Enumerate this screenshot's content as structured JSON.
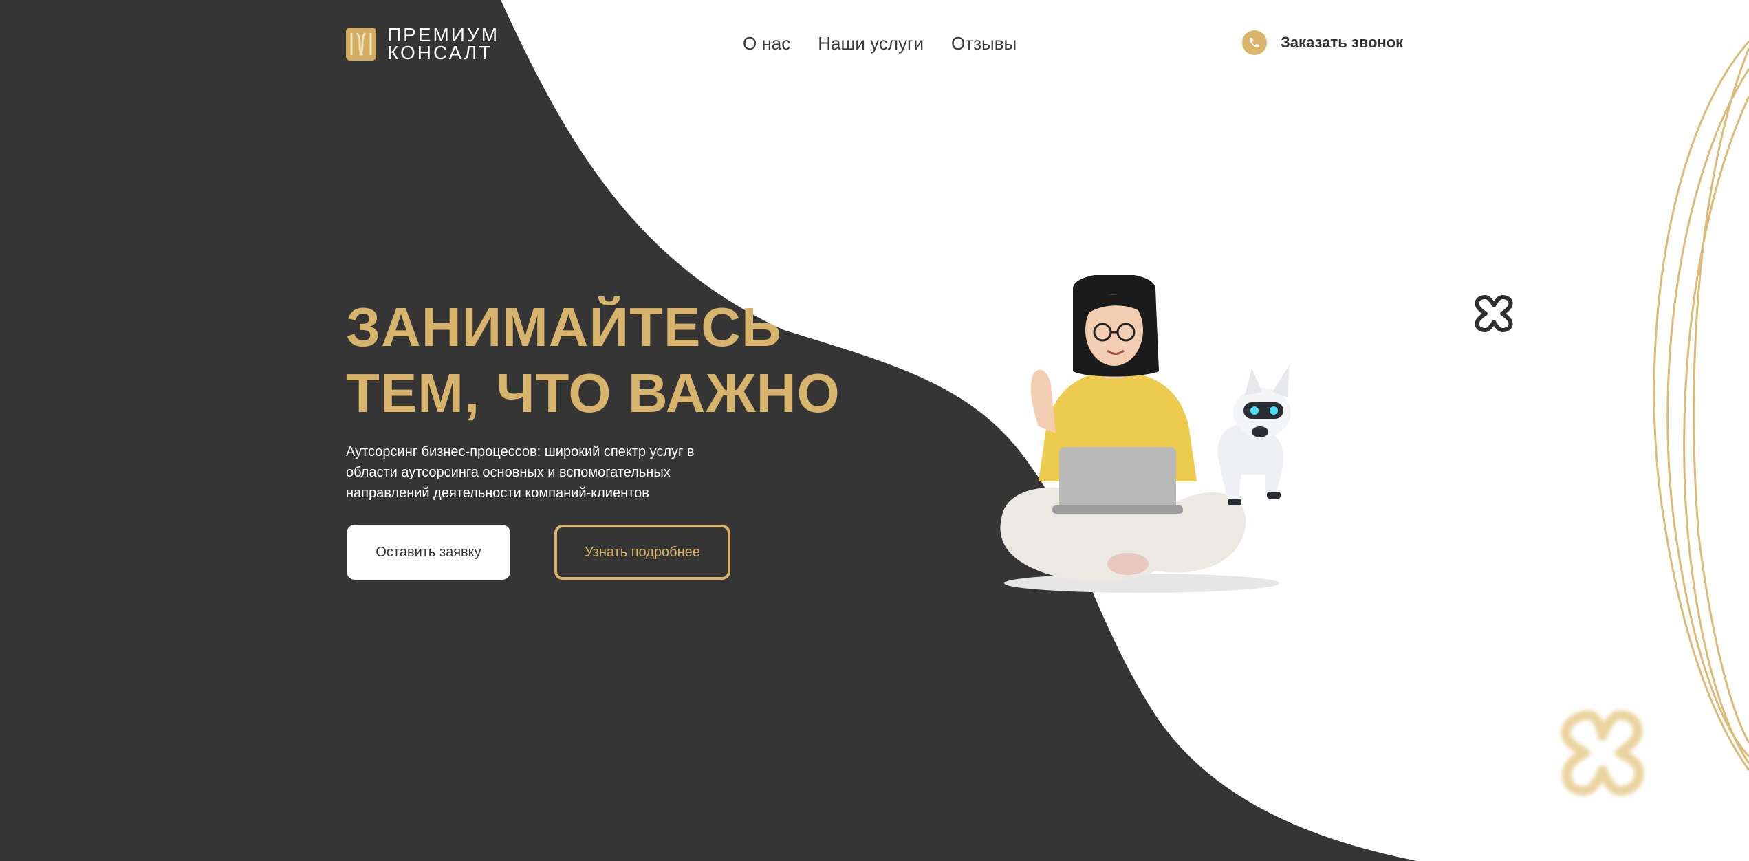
{
  "header": {
    "logo": {
      "line1": "ПРЕМИУМ",
      "line2": "КОНСАЛТ"
    },
    "nav": [
      {
        "label": "О нас"
      },
      {
        "label": "Наши услуги"
      },
      {
        "label": "Отзывы"
      }
    ],
    "call": {
      "label": "Заказать звонок",
      "icon": "phone-icon"
    }
  },
  "hero": {
    "title_line1": "ЗАНИМАЙТЕСЬ",
    "title_line2": "ТЕМ, ЧТО ВАЖНО",
    "subtitle": "Аутсорсинг бизнес-процессов: широкий спектр услуг в области аутсорсинга основных и вспомогательных направлений деятельности компаний-клиентов",
    "primary_button": "Оставить заявку",
    "secondary_button": "Узнать подробнее"
  },
  "colors": {
    "dark_background": "#353535",
    "gold": "#d9b46a",
    "title_gold": "#d7b36c",
    "text_dark": "#333333"
  }
}
